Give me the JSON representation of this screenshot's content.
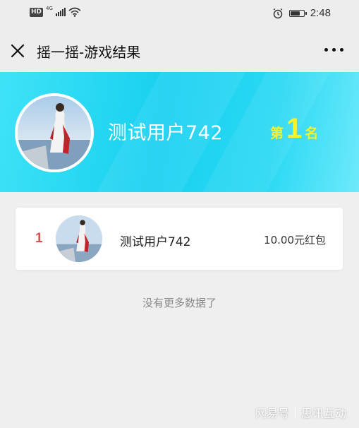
{
  "status_bar": {
    "hd": "HD",
    "network": "4G",
    "time": "2:48",
    "battery_level": 0.75,
    "icons": [
      "signal-icon",
      "wifi-icon",
      "alarm-icon",
      "battery-icon"
    ]
  },
  "nav": {
    "title": "摇一摇-游戏结果",
    "icons": [
      "close-icon",
      "more-icon"
    ]
  },
  "winner": {
    "name": "测试用户742",
    "rank_prefix": "第",
    "rank": "1",
    "rank_suffix": "名"
  },
  "ranking": [
    {
      "rank": "1",
      "name": "测试用户742",
      "prize": "10.00元红包"
    }
  ],
  "empty_text": "没有更多数据了",
  "watermark": {
    "brand": "网易号",
    "author": "思讯互动"
  },
  "colors": {
    "banner": "#17d0f0",
    "rank_badge": "#f6f32a",
    "rank_number": "#d6524c",
    "background": "#efeff0"
  }
}
